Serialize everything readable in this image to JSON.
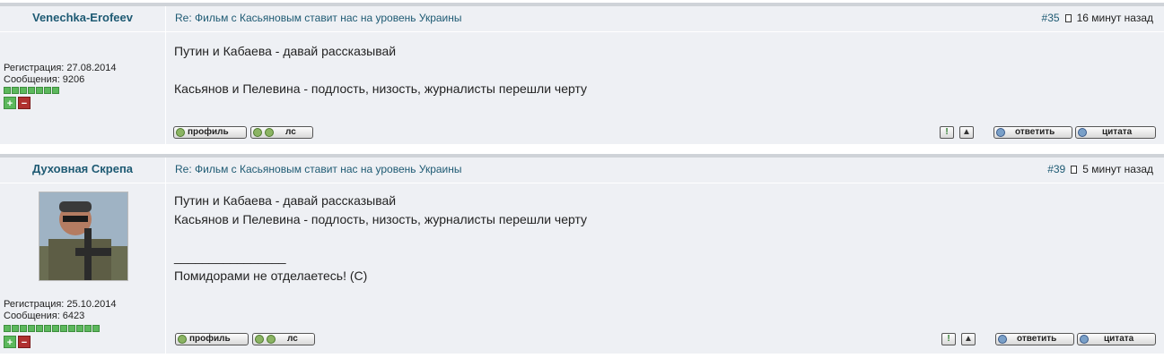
{
  "posts": [
    {
      "author": "Venechka-Erofeev",
      "registration": "Регистрация: 27.08.2014",
      "messages": "Сообщения: 9206",
      "rating_blocks": 7,
      "topic": "Re: Фильм с Касьяновым ставит нас на уровень Украины",
      "number": "#35",
      "time": "16 минут назад",
      "lines": [
        "Путин и Кабаева - давай рассказывай",
        "",
        "Касьянов и Пелевина - подлость, низость, журналисты перешли черту"
      ],
      "has_avatar": false
    },
    {
      "author": "Духовная Скрепа",
      "registration": "Регистрация: 25.10.2014",
      "messages": "Сообщения: 6423",
      "rating_blocks": 12,
      "topic": "Re: Фильм с Касьяновым ставит нас на уровень Украины",
      "number": "#39",
      "time": "5 минут назад",
      "lines": [
        "Путин и Кабаева - давай рассказывай",
        "Касьянов и Пелевина - подлость, низость, журналисты перешли черту",
        "",
        "________________",
        "Помидорами не отделаетесь! (С)"
      ],
      "has_avatar": true
    }
  ],
  "buttons": {
    "profile": "профиль",
    "pm": "лс",
    "reply": "ответить",
    "quote": "цитата",
    "report": "!"
  },
  "vote": {
    "plus": "+",
    "minus": "−"
  }
}
